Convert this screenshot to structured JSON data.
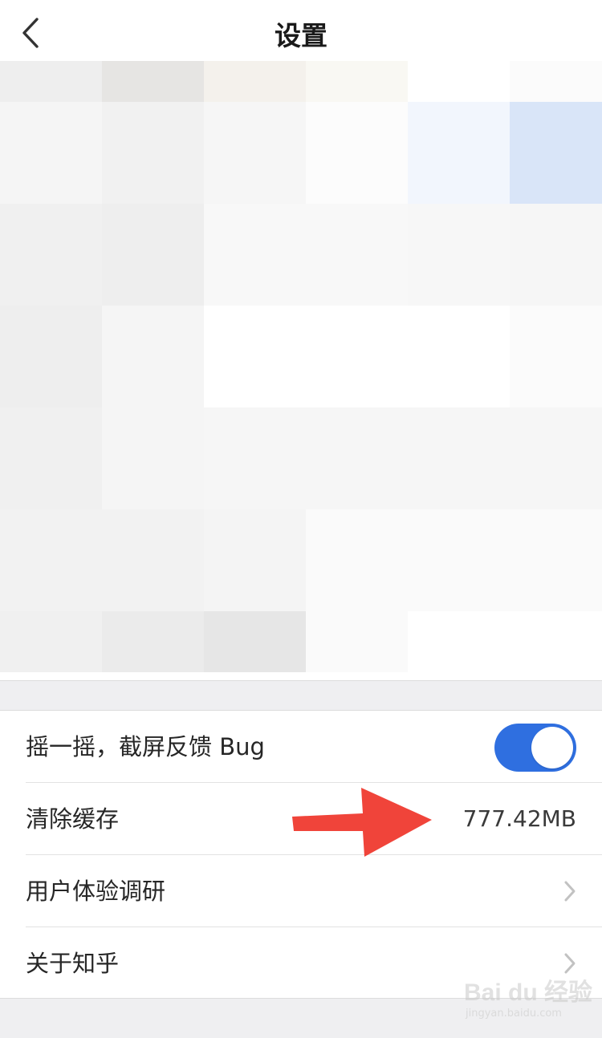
{
  "nav": {
    "title": "设置",
    "back_icon": "chevron-left-icon"
  },
  "settings": {
    "shake_feedback": {
      "label": "摇一摇，截屏反馈 Bug",
      "enabled": true
    },
    "clear_cache": {
      "label": "清除缓存",
      "value": "777.42MB"
    },
    "user_survey": {
      "label": "用户体验调研",
      "icon": "chevron-right-icon"
    },
    "about": {
      "label": "关于知乎",
      "icon": "chevron-right-icon"
    }
  },
  "colors": {
    "toggle_on": "#2f6fe0",
    "annotation_arrow": "#f0443a",
    "section_background": "#efeff1"
  },
  "watermark": {
    "brand": "Bai du 经验",
    "url": "jingyan.baidu.com"
  }
}
